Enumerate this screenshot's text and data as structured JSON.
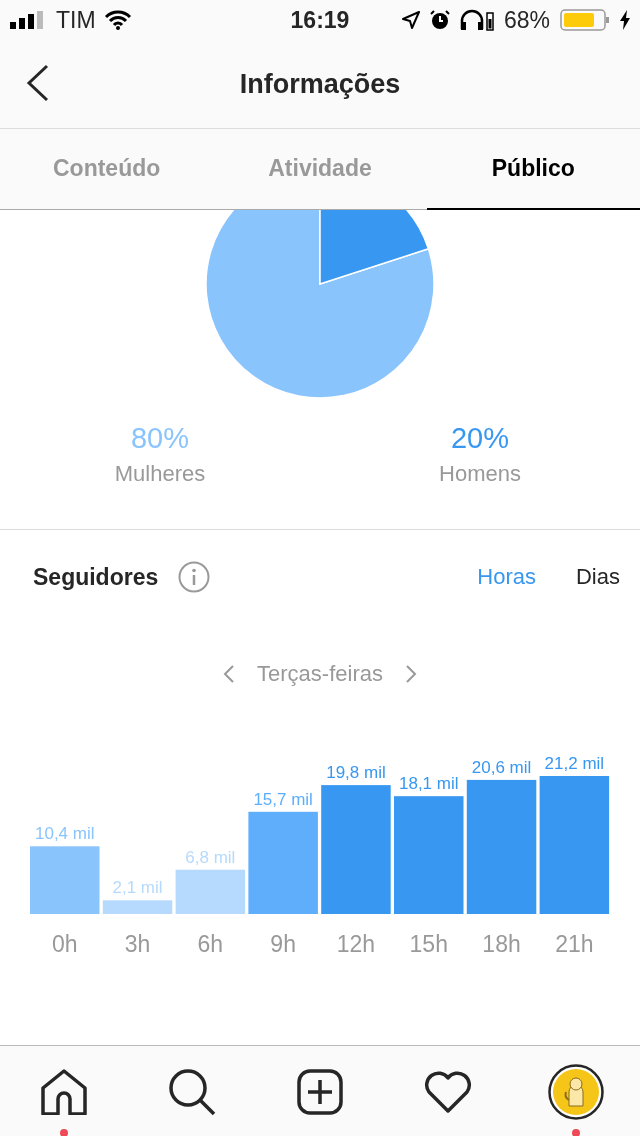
{
  "status_bar": {
    "carrier": "TIM",
    "time": "16:19",
    "battery": "68%"
  },
  "header": {
    "title": "Informações"
  },
  "tabs": [
    {
      "label": "Conteúdo",
      "selected": false
    },
    {
      "label": "Atividade",
      "selected": false
    },
    {
      "label": "Público",
      "selected": true
    }
  ],
  "gender": {
    "chart_data": {
      "type": "pie",
      "categories": [
        "Mulheres",
        "Homens"
      ],
      "values": [
        80,
        20
      ]
    },
    "legend": [
      {
        "value": "80%",
        "color": "#8ac4fd"
      },
      {
        "value": "20%",
        "color": "#3897f0"
      }
    ]
  },
  "followers": {
    "title": "Seguidores",
    "toggles": [
      {
        "label": "Horas",
        "selected": true
      },
      {
        "label": "Dias",
        "selected": false
      }
    ],
    "day": "Terças-feiras",
    "chart_data": {
      "type": "bar",
      "categories": [
        "0h",
        "3h",
        "6h",
        "9h",
        "12h",
        "15h",
        "18h",
        "21h"
      ],
      "values": [
        10.4,
        2.1,
        6.8,
        15.7,
        19.8,
        18.1,
        20.6,
        21.2
      ],
      "value_labels": [
        "10,4 mil",
        "2,1 mil",
        "6,8 mil",
        "15,7 mil",
        "19,8 mil",
        "18,1 mil",
        "20,6 mil",
        "21,2 mil"
      ]
    },
    "bars": [
      {
        "color": "#8ac4fd"
      },
      {
        "color": "#b6dafd"
      },
      {
        "color": "#b6dafd"
      },
      {
        "color": "#5eaefc"
      },
      {
        "color": "#3897f0"
      },
      {
        "color": "#3897f0"
      },
      {
        "color": "#3897f0"
      },
      {
        "color": "#3897f0"
      }
    ]
  },
  "nav": [
    {
      "kind": "home",
      "badge": true
    },
    {
      "kind": "search",
      "badge": false
    },
    {
      "kind": "add",
      "badge": false
    },
    {
      "kind": "heart",
      "badge": false
    },
    {
      "kind": "profile",
      "badge": true
    }
  ]
}
